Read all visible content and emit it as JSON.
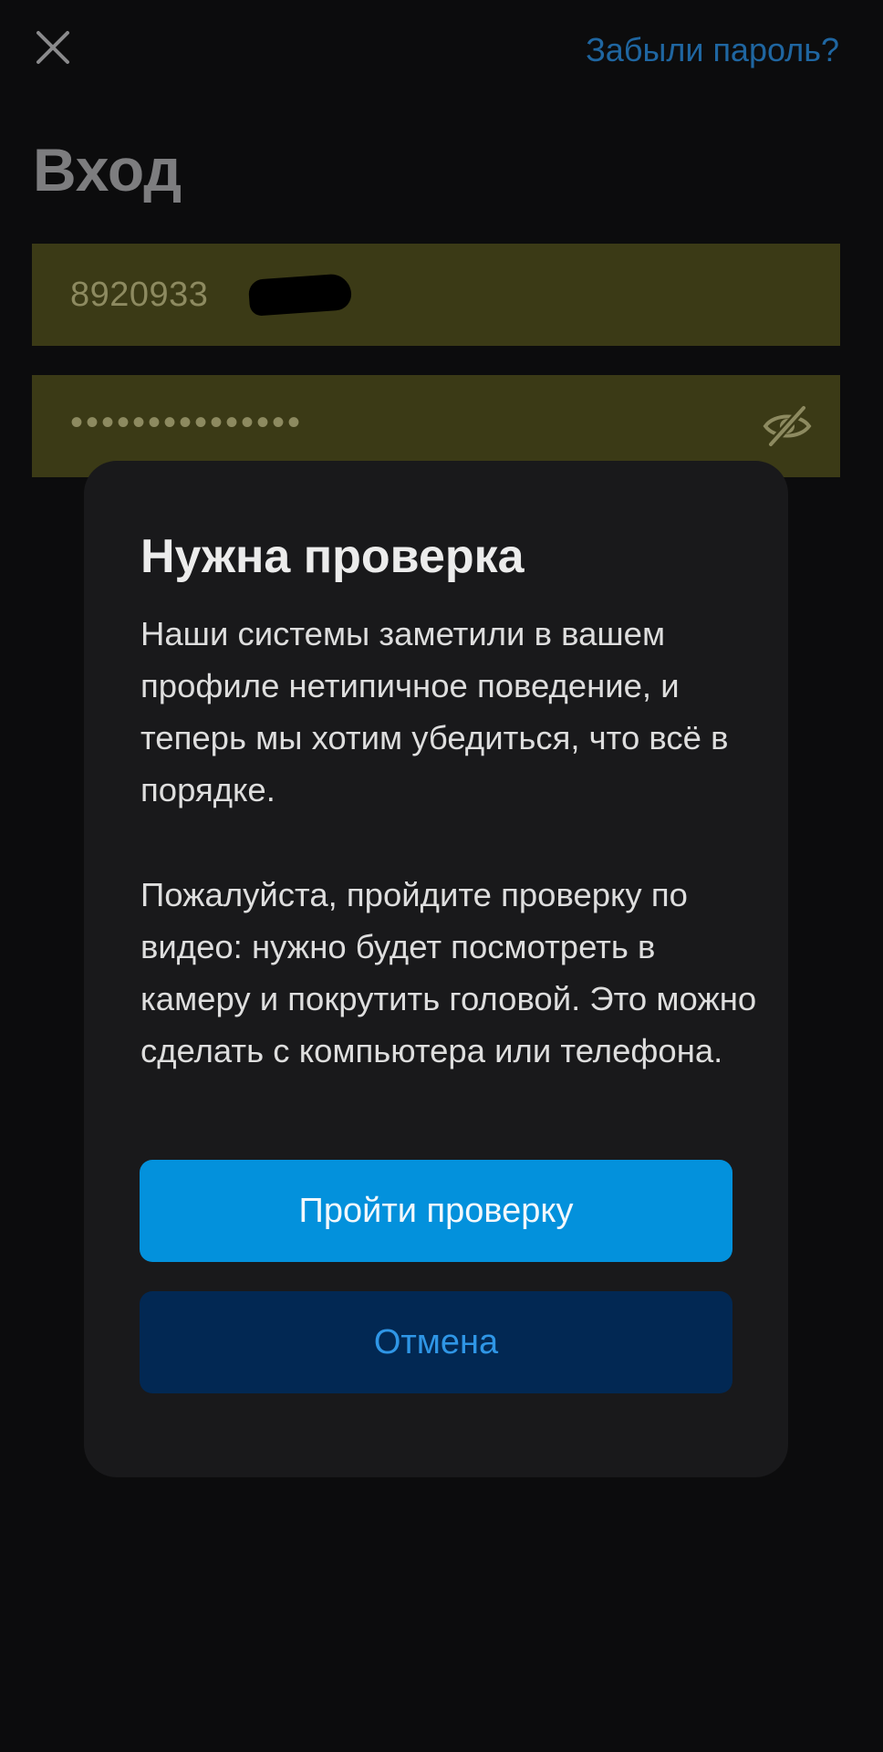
{
  "header": {
    "close_icon": "close-icon",
    "forgot_password": "Забыли пароль?"
  },
  "login": {
    "title": "Вход",
    "phone_value": "8920933",
    "password_value": "•••••••••••••••",
    "visibility_icon": "eye-off-icon"
  },
  "dialog": {
    "title": "Нужна проверка",
    "paragraph1": "Наши системы заметили в вашем профиле нетипичное поведение, и теперь мы хотим убедиться, что всё в порядке.",
    "paragraph2": "Пожалуйста, пройдите проверку по видео: нужно будет посмотреть в камеру и покрутить головой. Это можно сделать с компьютера или телефона.",
    "primary_button": "Пройти проверку",
    "secondary_button": "Отмена"
  },
  "colors": {
    "background": "#0c0c0d",
    "field_fill": "#3b3a16",
    "link": "#1f66a1",
    "dialog_bg": "#19191b",
    "primary": "#0391dc",
    "secondary": "#022853",
    "secondary_text": "#2f96e6"
  }
}
